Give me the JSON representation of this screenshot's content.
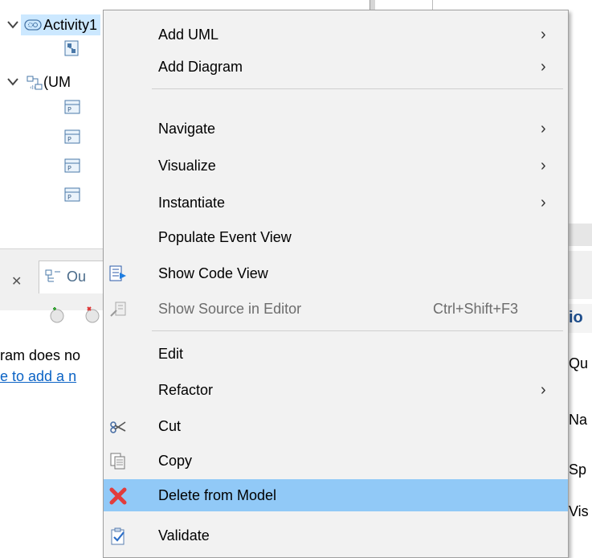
{
  "tree": {
    "activity_label": "Activity1",
    "package_label": "(UM"
  },
  "left_panel": {
    "tab_label": "Ou",
    "line1": "ram does no",
    "line2": "e to add a n"
  },
  "right_panel": {
    "heading_frag": "io",
    "row1": "Qu",
    "row2": "Na",
    "row3": "Sp",
    "row4": "Vis"
  },
  "menu": {
    "items": [
      {
        "label": "Add UML",
        "submenu": true
      },
      {
        "label": "Add Diagram",
        "submenu": true
      },
      {
        "label": "Navigate",
        "submenu": true
      },
      {
        "label": "Visualize",
        "submenu": true
      },
      {
        "label": "Instantiate",
        "submenu": true
      },
      {
        "label": "Populate Event View"
      },
      {
        "label": "Show Code View",
        "icon": "code-view-icon"
      },
      {
        "label": "Show Source in Editor",
        "accel": "Ctrl+Shift+F3",
        "disabled": true,
        "icon": "source-editor-icon"
      },
      {
        "label": "Edit"
      },
      {
        "label": "Refactor",
        "submenu": true
      },
      {
        "label": "Cut",
        "icon": "cut-icon"
      },
      {
        "label": "Copy",
        "icon": "copy-icon"
      },
      {
        "label": "Delete from Model",
        "icon": "delete-icon",
        "highlighted": true
      },
      {
        "label": "Validate",
        "icon": "validate-icon"
      }
    ],
    "arrow_glyph": "›"
  },
  "colors": {
    "menu_bg": "#f2f2f2",
    "highlight": "#91c9f7",
    "tree_selection": "#cce8ff",
    "link": "#0b63c5",
    "delete_red": "#e23c3c"
  }
}
